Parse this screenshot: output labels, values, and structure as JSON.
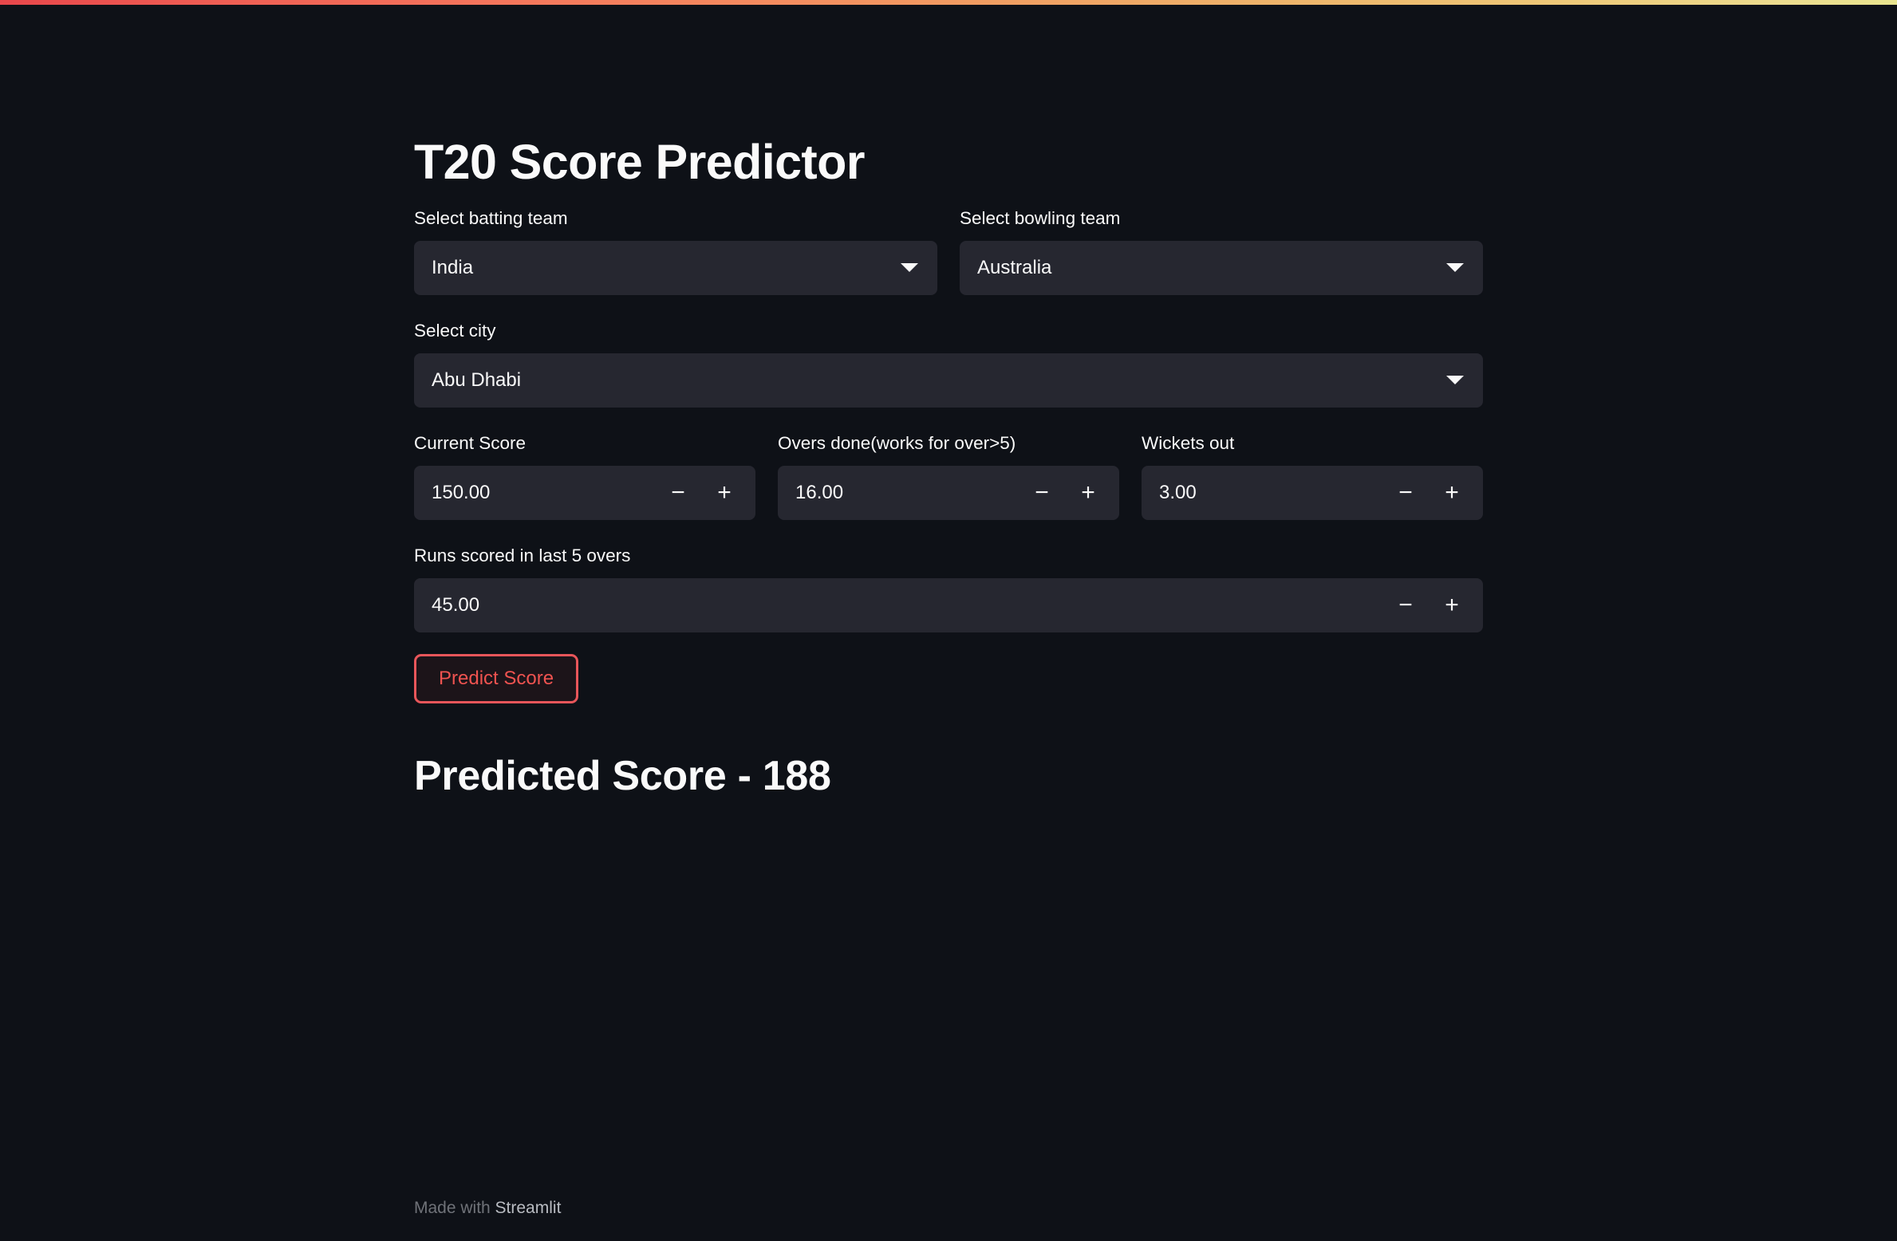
{
  "page": {
    "title": "T20 Score Predictor",
    "background_color": "#0e1117",
    "widget_background_color": "#262730",
    "text_color": "#fafafa",
    "accent_color": "#ff4b4b"
  },
  "top_bar": {
    "gradient_start_color": "#e8474b",
    "gradient_end_color": "#e9e58f"
  },
  "fields": {
    "batting_team": {
      "label": "Select batting team",
      "value": "India",
      "icon": "chevron-down-icon"
    },
    "bowling_team": {
      "label": "Select bowling team",
      "value": "Australia",
      "icon": "chevron-down-icon"
    },
    "city": {
      "label": "Select city",
      "value": "Abu Dhabi",
      "icon": "chevron-down-icon"
    },
    "current_score": {
      "label": "Current Score",
      "value": "150.00",
      "decrement": "−",
      "increment": "+"
    },
    "overs_done": {
      "label": "Overs done(works for over>5)",
      "value": "16.00",
      "decrement": "−",
      "increment": "+"
    },
    "wickets_out": {
      "label": "Wickets out",
      "value": "3.00",
      "decrement": "−",
      "increment": "+"
    },
    "runs_last_5": {
      "label": "Runs scored in last 5 overs",
      "value": "45.00",
      "decrement": "−",
      "increment": "+"
    }
  },
  "actions": {
    "predict_label": "Predict Score"
  },
  "result": {
    "heading": "Predicted Score - 188"
  },
  "footer": {
    "made_with": "Made with ",
    "brand": "Streamlit"
  }
}
